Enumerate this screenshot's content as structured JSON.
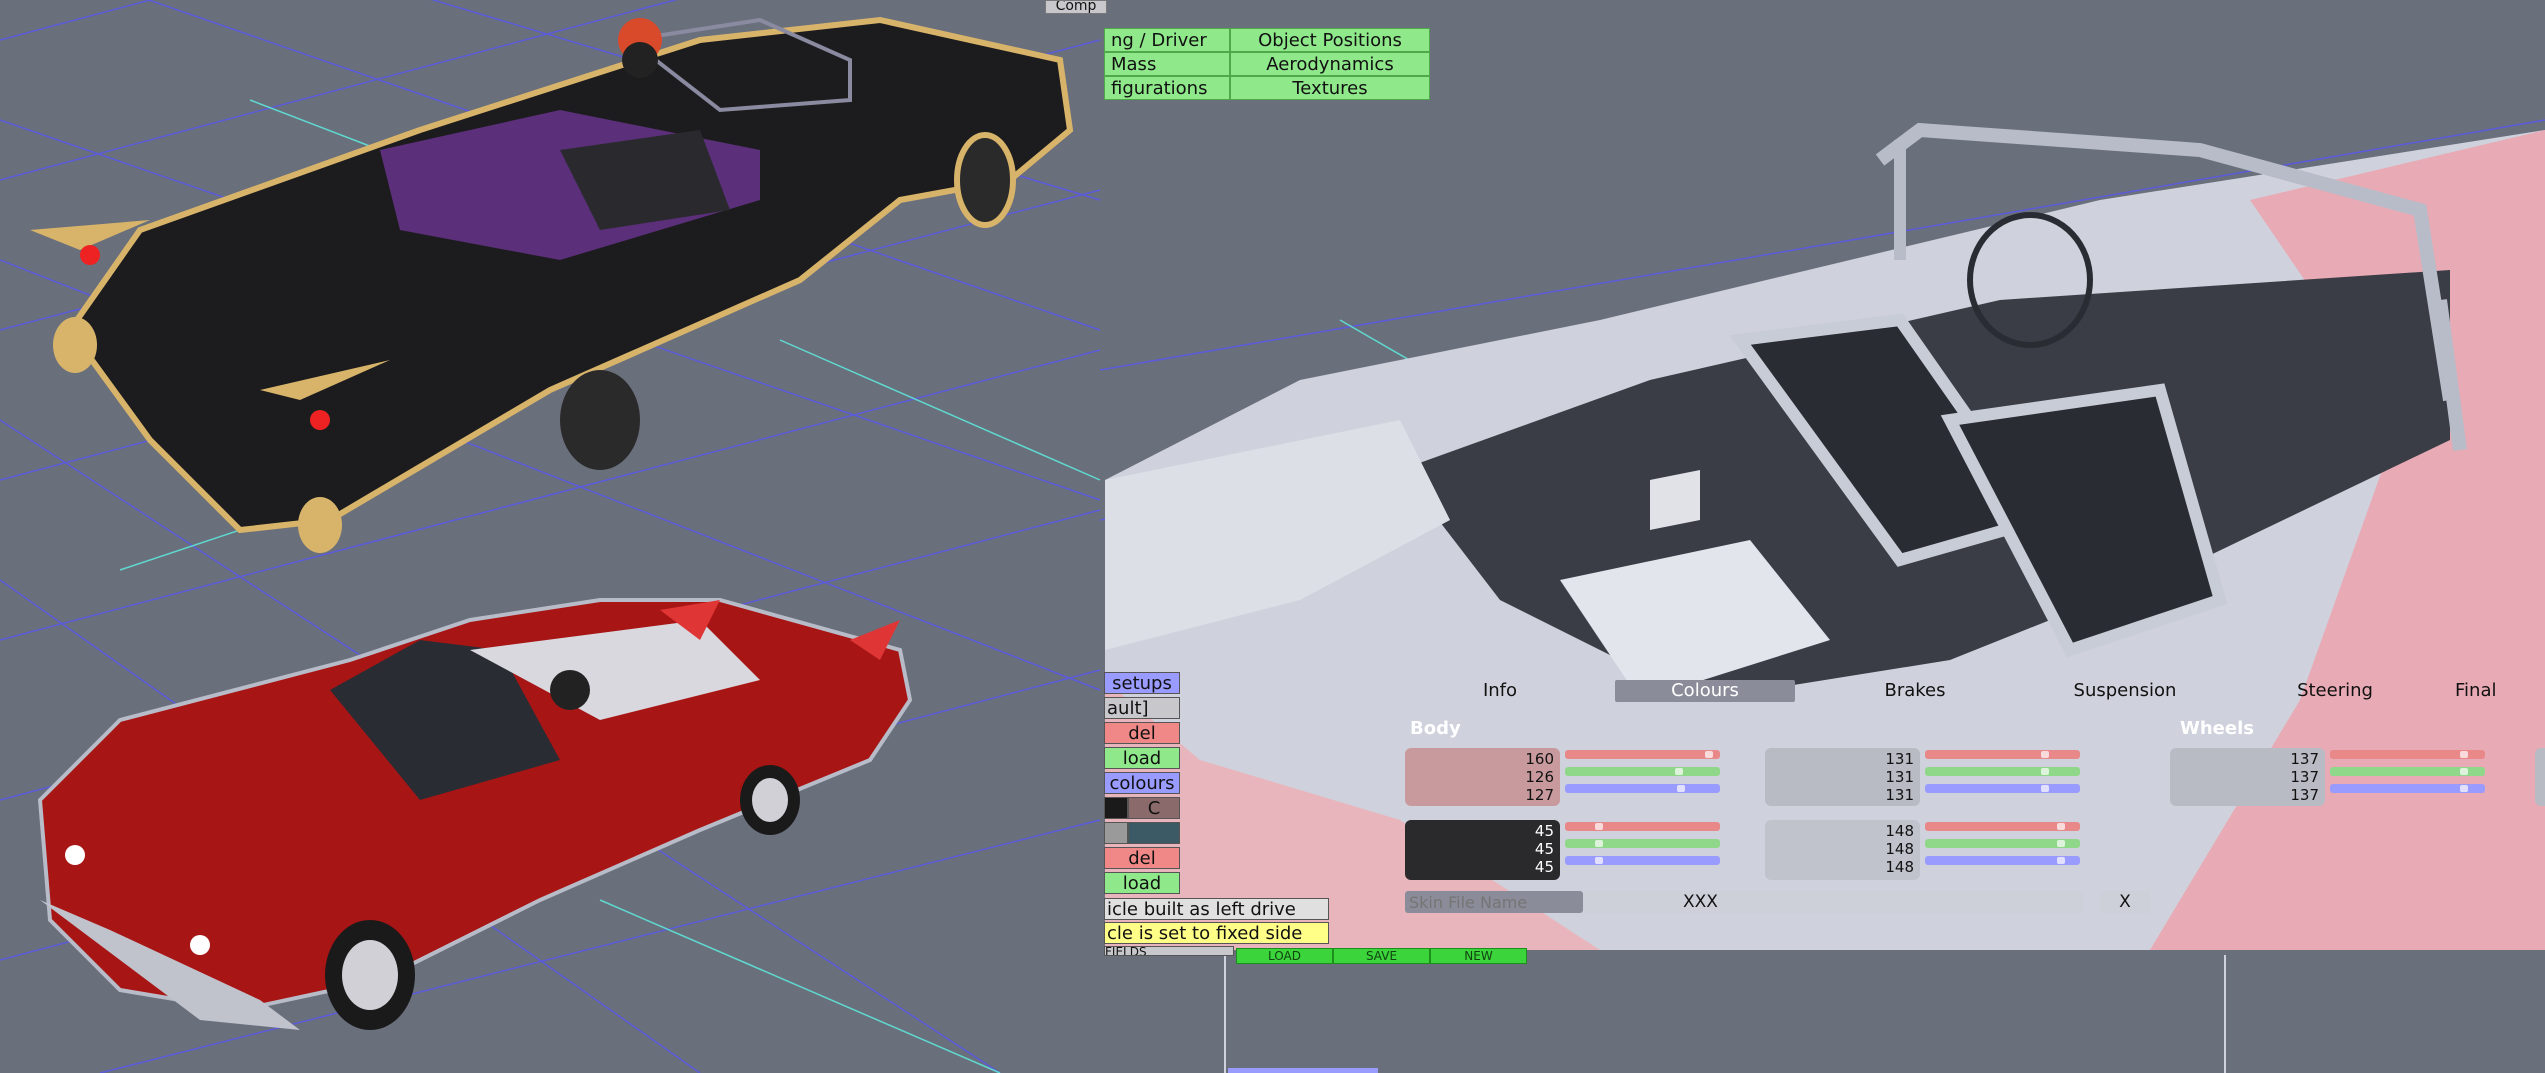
{
  "window": {
    "compile_label": "Comp"
  },
  "top_menu": {
    "rows": [
      [
        "ng / Driver",
        "Object Positions"
      ],
      [
        "Mass",
        "Aerodynamics"
      ],
      [
        "figurations",
        "Textures"
      ]
    ]
  },
  "side_panel": {
    "setups_label": "setups",
    "default_label": "ault]",
    "del_label": "del",
    "load_label": "load",
    "colours_label": "colours",
    "c_label": "C",
    "del2_label": "del",
    "load2_label": "load",
    "left_drive_note": "icle built as left drive",
    "fixed_side_note": "cle is set to fixed side",
    "fields_label": "FIELDS"
  },
  "bottom_buttons": {
    "load": "LOAD",
    "save": "SAVE",
    "new": "NEW"
  },
  "tabs": [
    "Info",
    "Colours",
    "Brakes",
    "Suspension",
    "Steering",
    "Final"
  ],
  "active_tab": "Colours",
  "colour_panel": {
    "body_label": "Body",
    "wheels_label": "Wheels",
    "body_rgb": [
      "160",
      "126",
      "127"
    ],
    "body_second_rgb": [
      "131",
      "131",
      "131"
    ],
    "wheels_rgb": [
      "137",
      "137",
      "137"
    ],
    "dark_rgb": [
      "45",
      "45",
      "45"
    ],
    "light_rgb": [
      "148",
      "148",
      "148"
    ],
    "skin_file_placeholder": "Skin File Name",
    "skin_value": "XXX",
    "close_label": "X"
  },
  "colors": {
    "background": "#6a6f7c",
    "menu_green": "#8fe88a",
    "button_blue": "#9a9bff",
    "button_red": "#f08888",
    "button_green": "#8fe88a",
    "note_yellow": "#ffff88",
    "car_black": "#1c1c1e",
    "car_gold": "#d8b46a",
    "car_red": "#a81515",
    "car_pink": "#e8aab4",
    "interior_white": "#cfd2dc"
  },
  "icons": [
    "grid-floor",
    "car-black-convertible",
    "car-red-convertible",
    "car-pink-interior"
  ]
}
